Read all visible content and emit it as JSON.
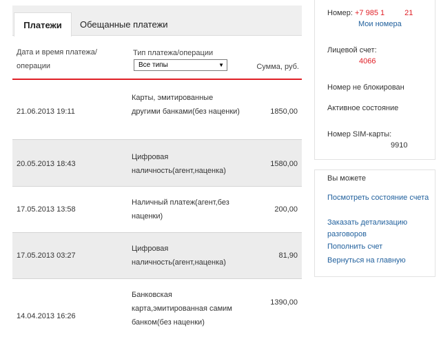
{
  "tabs": [
    {
      "label": "Платежи",
      "active": true
    },
    {
      "label": "Обещанные платежи",
      "active": false
    }
  ],
  "table": {
    "columns": {
      "date": "Дата и время платежа/операции",
      "type": "Тип платежа/операции",
      "sum": "Сумма, руб."
    },
    "filter": {
      "selected": "Все типы"
    },
    "rows": [
      {
        "date": "21.06.2013 19:11",
        "type": "Карты, эмитированные другими банками(без наценки)",
        "sum": "1850,00"
      },
      {
        "date": "20.05.2013 18:43",
        "type": "Цифровая наличность(агент,наценка)",
        "sum": "1580,00"
      },
      {
        "date": "17.05.2013 13:58",
        "type": "Наличный платеж(агент,без наценки)",
        "sum": "200,00"
      },
      {
        "date": "17.05.2013 03:27",
        "type": "Цифровая наличность(агент,наценка)",
        "sum": "81,90"
      },
      {
        "date": "14.04.2013 16:26",
        "type": "Банковская карта,эмитированная самим банком(без наценки)",
        "sum": "1390,00"
      }
    ]
  },
  "account": {
    "number_label": "Номер:",
    "number_prefix": "+7 985 1",
    "number_suffix": "21",
    "my_numbers": "Мои номера",
    "account_label": "Лицевой счет:",
    "account_value": "4066",
    "block_status": "Номер не блокирован",
    "state": "Активное состояние",
    "sim_label": "Номер SIM-карты:",
    "sim_value": "9910"
  },
  "actions": {
    "title": "Вы можете",
    "items": [
      "Посмотреть состояние счета",
      "Заказать детализацию разговоров",
      "Пополнить счет",
      "Вернуться на главную"
    ]
  },
  "colors": {
    "accent": "#e01e25",
    "link": "#1f5f9c"
  }
}
